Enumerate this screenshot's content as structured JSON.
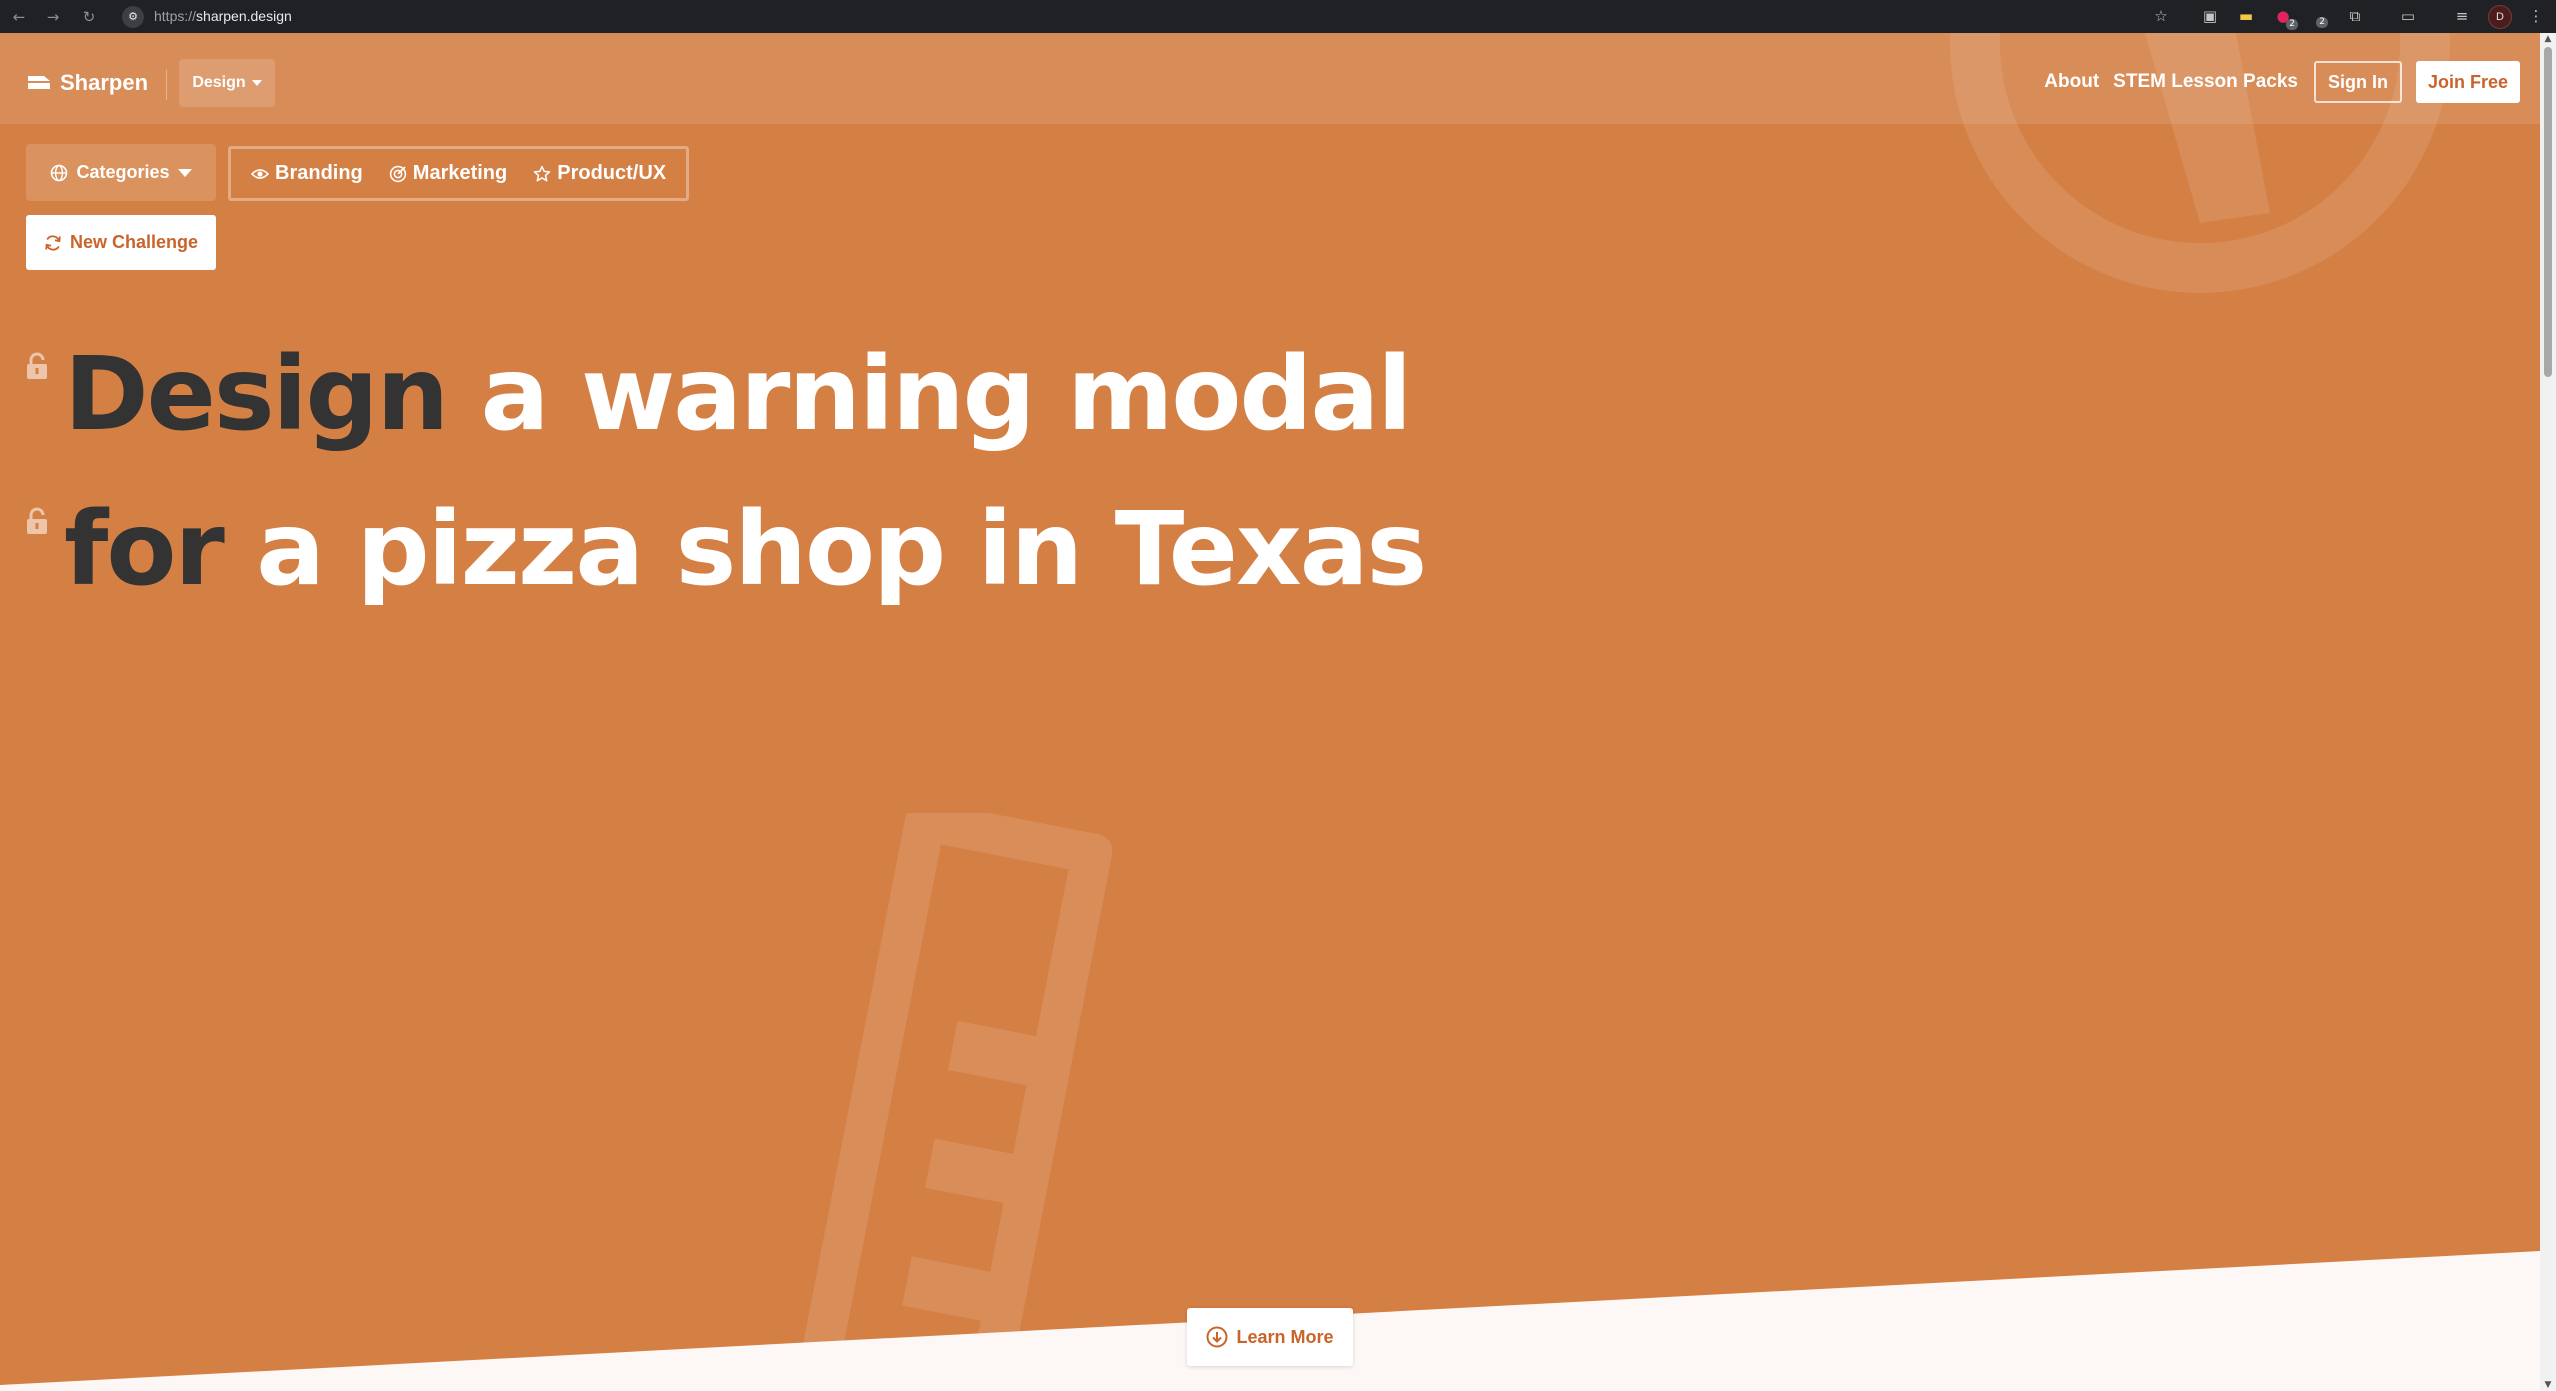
{
  "browser": {
    "url_scheme": "https://",
    "url_host": "sharpen.design",
    "profile_initial": "D",
    "ext_badge_1": "2",
    "ext_badge_2": "2"
  },
  "header": {
    "brand": "Sharpen",
    "mode_dropdown": "Design",
    "links": [
      "About",
      "STEM Lesson Packs"
    ],
    "sign_in": "Sign In",
    "join": "Join Free"
  },
  "categories": {
    "button": "Categories",
    "items": [
      "Branding",
      "Marketing",
      "Product/UX"
    ]
  },
  "new_challenge": "New Challenge",
  "prompt": {
    "line1_verb": "Design",
    "line1_rest": "a warning modal",
    "line2_verb": "for",
    "line2_rest": "a pizza shop in Texas"
  },
  "learn_more": "Learn More",
  "colors": {
    "background": "#d47f44",
    "accent_text": "#c9642a",
    "dark_word": "#333333"
  }
}
